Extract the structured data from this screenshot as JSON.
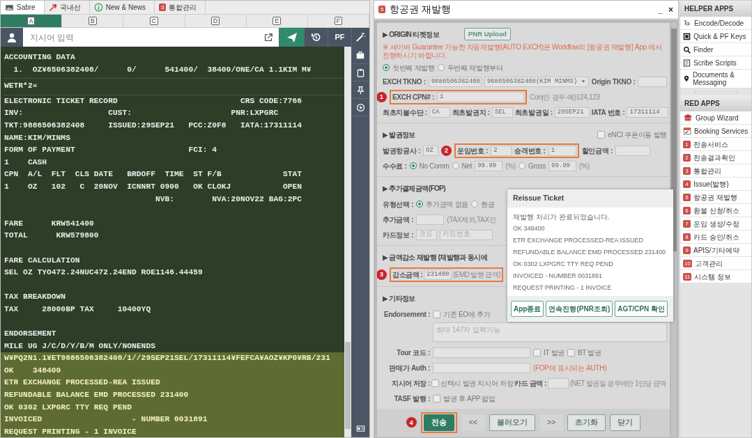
{
  "terminal": {
    "tabs": [
      {
        "label": "Sabre",
        "selected": true
      },
      {
        "label": "국내선",
        "selected": false
      },
      {
        "label": "New & News",
        "selected": false
      },
      {
        "label": "통합관리",
        "badge": "3",
        "selected": false
      }
    ],
    "columns": [
      {
        "label": "A",
        "selected": true
      },
      {
        "label": "B",
        "selected": false
      },
      {
        "label": "C",
        "selected": false
      },
      {
        "label": "D",
        "selected": false
      },
      {
        "label": "E",
        "selected": false
      },
      {
        "label": "F",
        "selected": false
      }
    ],
    "command": {
      "placeholder": "지시어 입력"
    },
    "pf_label": "PF",
    "blocks": [
      {
        "kind": "entry",
        "lines": [
          "ACCOUNTING DATA",
          "  1.  OZ¥6506382408/      0/      541400/  38400/ONE/CA 1.1KIM M¥"
        ]
      },
      {
        "kind": "entry",
        "lines": [
          "WETR*2«"
        ]
      },
      {
        "kind": "section",
        "lines": [
          "ELECTRONIC TICKET RECORD                          CRS CODE:7766",
          "INV:                  CUST:                     PNR:LXPGRC",
          "TKT:9886506382408     ISSUED:29SEP21   PCC:Z0F8   IATA:17311114",
          "NAME:KIM/MINMS",
          "FORM OF PAYMENT                        FCI: 4",
          "1    CASH",
          "CPN  A/L  FLT  CLS DATE   BRDOFF  TIME  ST F/B             STAT",
          "1    OZ   102   C  20NOV  ICNNRT 0900   OK CLOKJ           OPEN",
          "                                NVB:        NVA:20NOV22 BAG:2PC"
        ]
      },
      {
        "kind": "section",
        "lines": [
          "FARE      KRW541400",
          "TOTAL      KRW579800"
        ]
      },
      {
        "kind": "section",
        "lines": [
          "FARE CALCULATION",
          "SEL OZ TYO472.24NUC472.24END ROE1146.44459"
        ]
      },
      {
        "kind": "section",
        "lines": [
          "TAX BREAKDOWN",
          "TAX     28000BP TAX     10400YQ"
        ]
      },
      {
        "kind": "section",
        "lines": [
          "ENDORSEMENT",
          "MILE UG J/C/D/Y/B/M ONLY/NONENDS"
        ]
      },
      {
        "kind": "response",
        "lines": [
          "W¥PQ2N1.1¥ET9886506382408/1//29SEP21SEL/17311114¥FEFCA¥AOZ¥KP0¥RB/231",
          "OK    348400",
          "ETR EXCHANGE PROCESSED-REA ISSUED",
          "REFUNDABLE BALANCE EMD PROCESSED 231400",
          "OK 0302 LXPGRC TTY REQ PEND",
          "INVOICED                   - NUMBER 0031891",
          "REQUEST PRINTING - 1 INVOICE"
        ]
      }
    ]
  },
  "reissue": {
    "app_badge": "5",
    "title": "항공권 재발행",
    "minimize": "_",
    "close": "×",
    "origin": {
      "heading": "▶ ORIGIN 티켓정보",
      "upload_button": "PNR Upload",
      "notice": "※ 세이버 Guarantee 가능한 자동재발행(AUTO EXCH)은 Workflow의 [항공권 재발행] App 에서 진행하시기 바랍니다.",
      "radios": [
        {
          "label": "첫번째 재발행",
          "selected": true
        },
        {
          "label": "두번째 재발행부터",
          "selected": false
        }
      ],
      "exch_tkno": {
        "label": "EXCH TKNO :",
        "value": "9886506382408",
        "select": "9886506382408(KIM MINMS)"
      },
      "origin_tkno": {
        "label": "Origin TKNO :"
      },
      "exch_cpn": {
        "callout": "1",
        "label": "EXCH CPN# :",
        "value": "1",
        "hint": "Conj인 경우-예)124,123"
      },
      "first_issue": [
        {
          "label": "최초지불수단 :",
          "value": "CA"
        },
        {
          "label": "최초발권지 :",
          "value": "SEL"
        },
        {
          "label": "최초발권일 :",
          "value": "29SEP21"
        },
        {
          "label": "IATA 번호 :",
          "value": "17311114"
        }
      ]
    },
    "issue": {
      "heading": "▶ 발권정보",
      "enci": {
        "label": "eNCI 쿠폰이용 발행",
        "checked": false
      },
      "airline": {
        "label": "발권항공사 :",
        "value": "OZ"
      },
      "callout": "2",
      "fare_no": {
        "label": "운임번호 :",
        "value": "2"
      },
      "pax_no": {
        "label": "승객번호 :",
        "value": "1"
      },
      "discount": {
        "label": "할인금액 :"
      },
      "commission": {
        "label": "수수료 :",
        "options": [
          {
            "label": "No Comm",
            "selected": true
          },
          {
            "label": "Net",
            "selected": false,
            "value": "99.99",
            "unit": "(%)"
          },
          {
            "label": "Gross",
            "selected": false,
            "value": "99.99",
            "unit": "(%)"
          }
        ]
      }
    },
    "fop": {
      "heading": "▶ 추가결제금액(FOP)",
      "type": {
        "label": "유형선택 :",
        "options": [
          {
            "label": "추가금액 없음",
            "selected": true
          },
          {
            "label": "현금",
            "selected": false
          }
        ]
      },
      "amount": {
        "label": "추가금액 :",
        "hint": "(TAX제외,TAX인"
      },
      "card": {
        "label": "카드정보 :",
        "code_placeholder": "코드",
        "number_placeholder": "카드번호"
      }
    },
    "decrease": {
      "heading": "▶ 금액감소 재발행 (재발행과 동시에",
      "callout": "3",
      "label": "감소금액 :",
      "value": "231400",
      "hint": "(EMD 발행 금액)"
    },
    "etc": {
      "heading": "▶ 기타정보",
      "endorsement": {
        "label": "Endorsement :",
        "checkbox": "기존 EO에 추가",
        "checked": false,
        "placeholder": "최대 147자 입력가능"
      },
      "tour": {
        "label": "Tour 코드 :",
        "checks": [
          {
            "label": "IT 발권",
            "checked": false
          },
          {
            "label": "BT 발권",
            "checked": false
          }
        ]
      },
      "auth": {
        "label": "판매가 Auth :",
        "hint": "(FOP에 표시되는 AUTH)"
      },
      "save": {
        "label": "지시어 저장 :",
        "checkbox": "선택시 발권 지시어 저장",
        "checked": false,
        "card_label": "카드 금액 :",
        "card_hint": "(NET 발권일 경우에만 1인당 금액"
      },
      "tasf": {
        "label": "TASF 발행 :",
        "checkbox": "발권 후 APP 팝업",
        "checked": false
      }
    },
    "footer": {
      "callout": "4",
      "buttons": [
        {
          "label": "전송",
          "kind": "primary"
        },
        {
          "label": "<<",
          "kind": "disabled"
        },
        {
          "label": "불러오기",
          "kind": "outline"
        },
        {
          "label": ">>",
          "kind": "disabled"
        },
        {
          "label": "초기화",
          "kind": "outline"
        },
        {
          "label": "닫기",
          "kind": "outline"
        }
      ]
    },
    "dialog": {
      "title": "Reissue Ticket",
      "lines": [
        "재발행 처리가 완료되었습니다.",
        "OK 348400",
        "ETR EXCHANGE PROCESSED-REA ISSUED",
        "REFUNDABLE BALANCE EMD PROCESSED 231400",
        "OK 0302 LXPGRC TTY REQ PEND",
        "INVOICED - NUMBER 0031891",
        "REQUEST PRINTING - 1 INVOICE"
      ],
      "buttons": [
        "App종료",
        "연속진행(PNR조회)",
        "AGT/CPN 확인"
      ]
    }
  },
  "sidebar": {
    "sections": [
      {
        "title": "HELPER APPS",
        "items": [
          {
            "label": "Encode/Decode"
          },
          {
            "label": "Quick & PF Keys"
          },
          {
            "label": "Finder"
          },
          {
            "label": "Scribe Scripts"
          },
          {
            "label": "Documents & Messaging"
          }
        ]
      },
      {
        "title": "RED APPS",
        "items": [
          {
            "label": "Group Wizard"
          },
          {
            "label": "Booking Services"
          },
          {
            "label": "전송서비스",
            "badge": "1"
          },
          {
            "label": "전송결과확인",
            "badge": "2"
          },
          {
            "label": "통합관리",
            "badge": "3"
          },
          {
            "label": "Issue(발행)",
            "badge": "4"
          },
          {
            "label": "항공권 재발행",
            "badge": "5"
          },
          {
            "label": "환불 신청/취소",
            "badge": "6"
          },
          {
            "label": "운임 생성/수정",
            "badge": "7"
          },
          {
            "label": "카드 승인/취소",
            "badge": "8"
          },
          {
            "label": "APIS/기타예약",
            "badge": "9"
          },
          {
            "label": "고객관리",
            "badge": "10"
          },
          {
            "label": "시스템 정보",
            "badge": "11"
          }
        ]
      }
    ]
  }
}
